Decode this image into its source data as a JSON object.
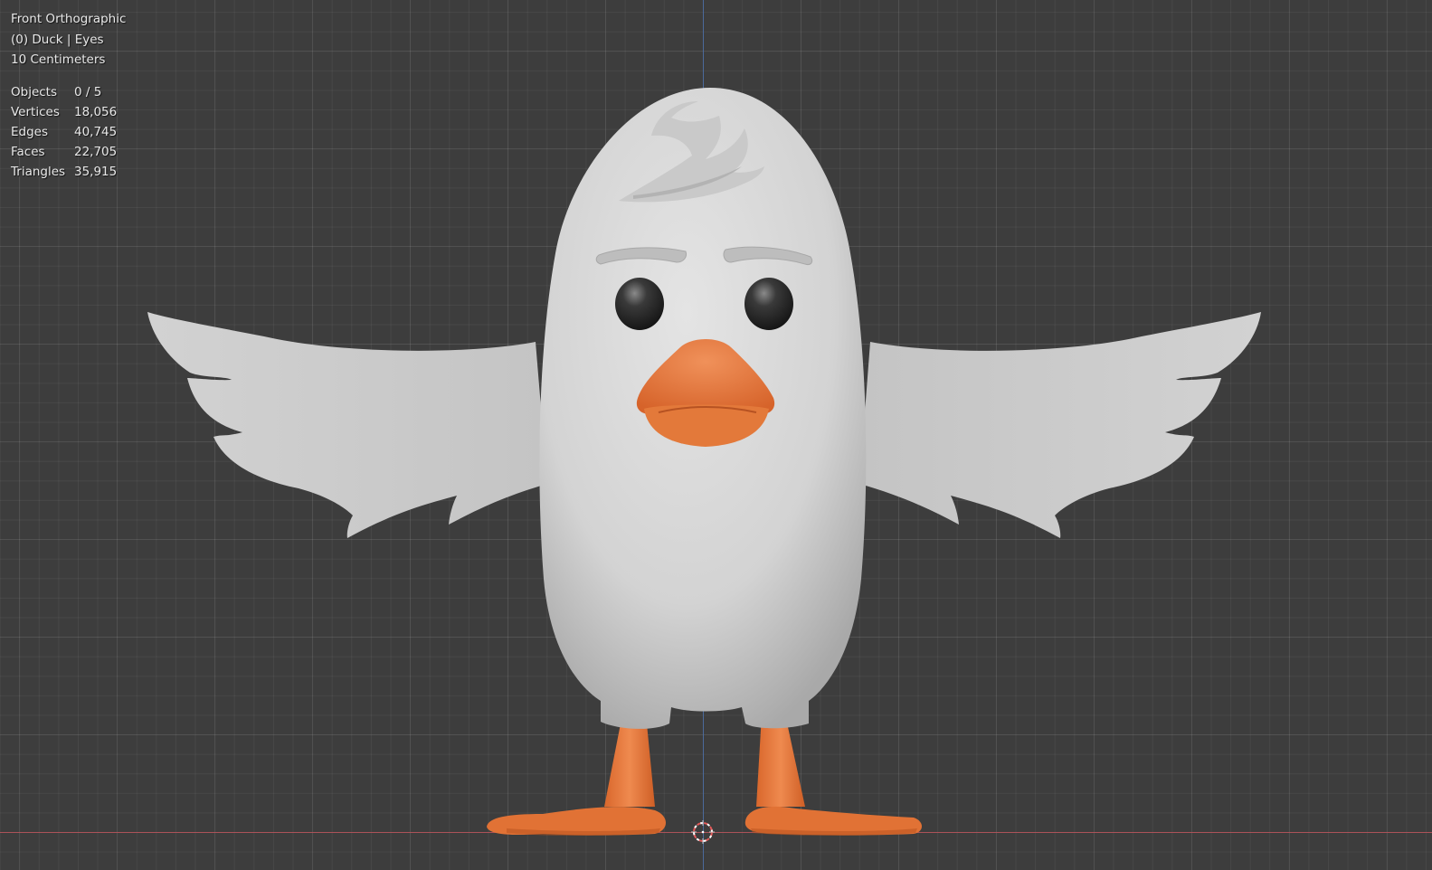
{
  "viewport": {
    "view_name": "Front Orthographic",
    "collection_info": "(0) Duck | Eyes",
    "grid_scale": "10 Centimeters"
  },
  "statistics": [
    {
      "label": "Objects",
      "value": "0 / 5"
    },
    {
      "label": "Vertices",
      "value": "18,056"
    },
    {
      "label": "Edges",
      "value": "40,745"
    },
    {
      "label": "Faces",
      "value": "22,705"
    },
    {
      "label": "Triangles",
      "value": "35,915"
    }
  ],
  "colors": {
    "background": "#3d3d3d",
    "axis_x": "#b5525a",
    "axis_z": "#4a6fa8",
    "body": "#d6d6d6",
    "beak_feet": "#e2763a"
  },
  "icons": [
    "3d-cursor-icon"
  ]
}
